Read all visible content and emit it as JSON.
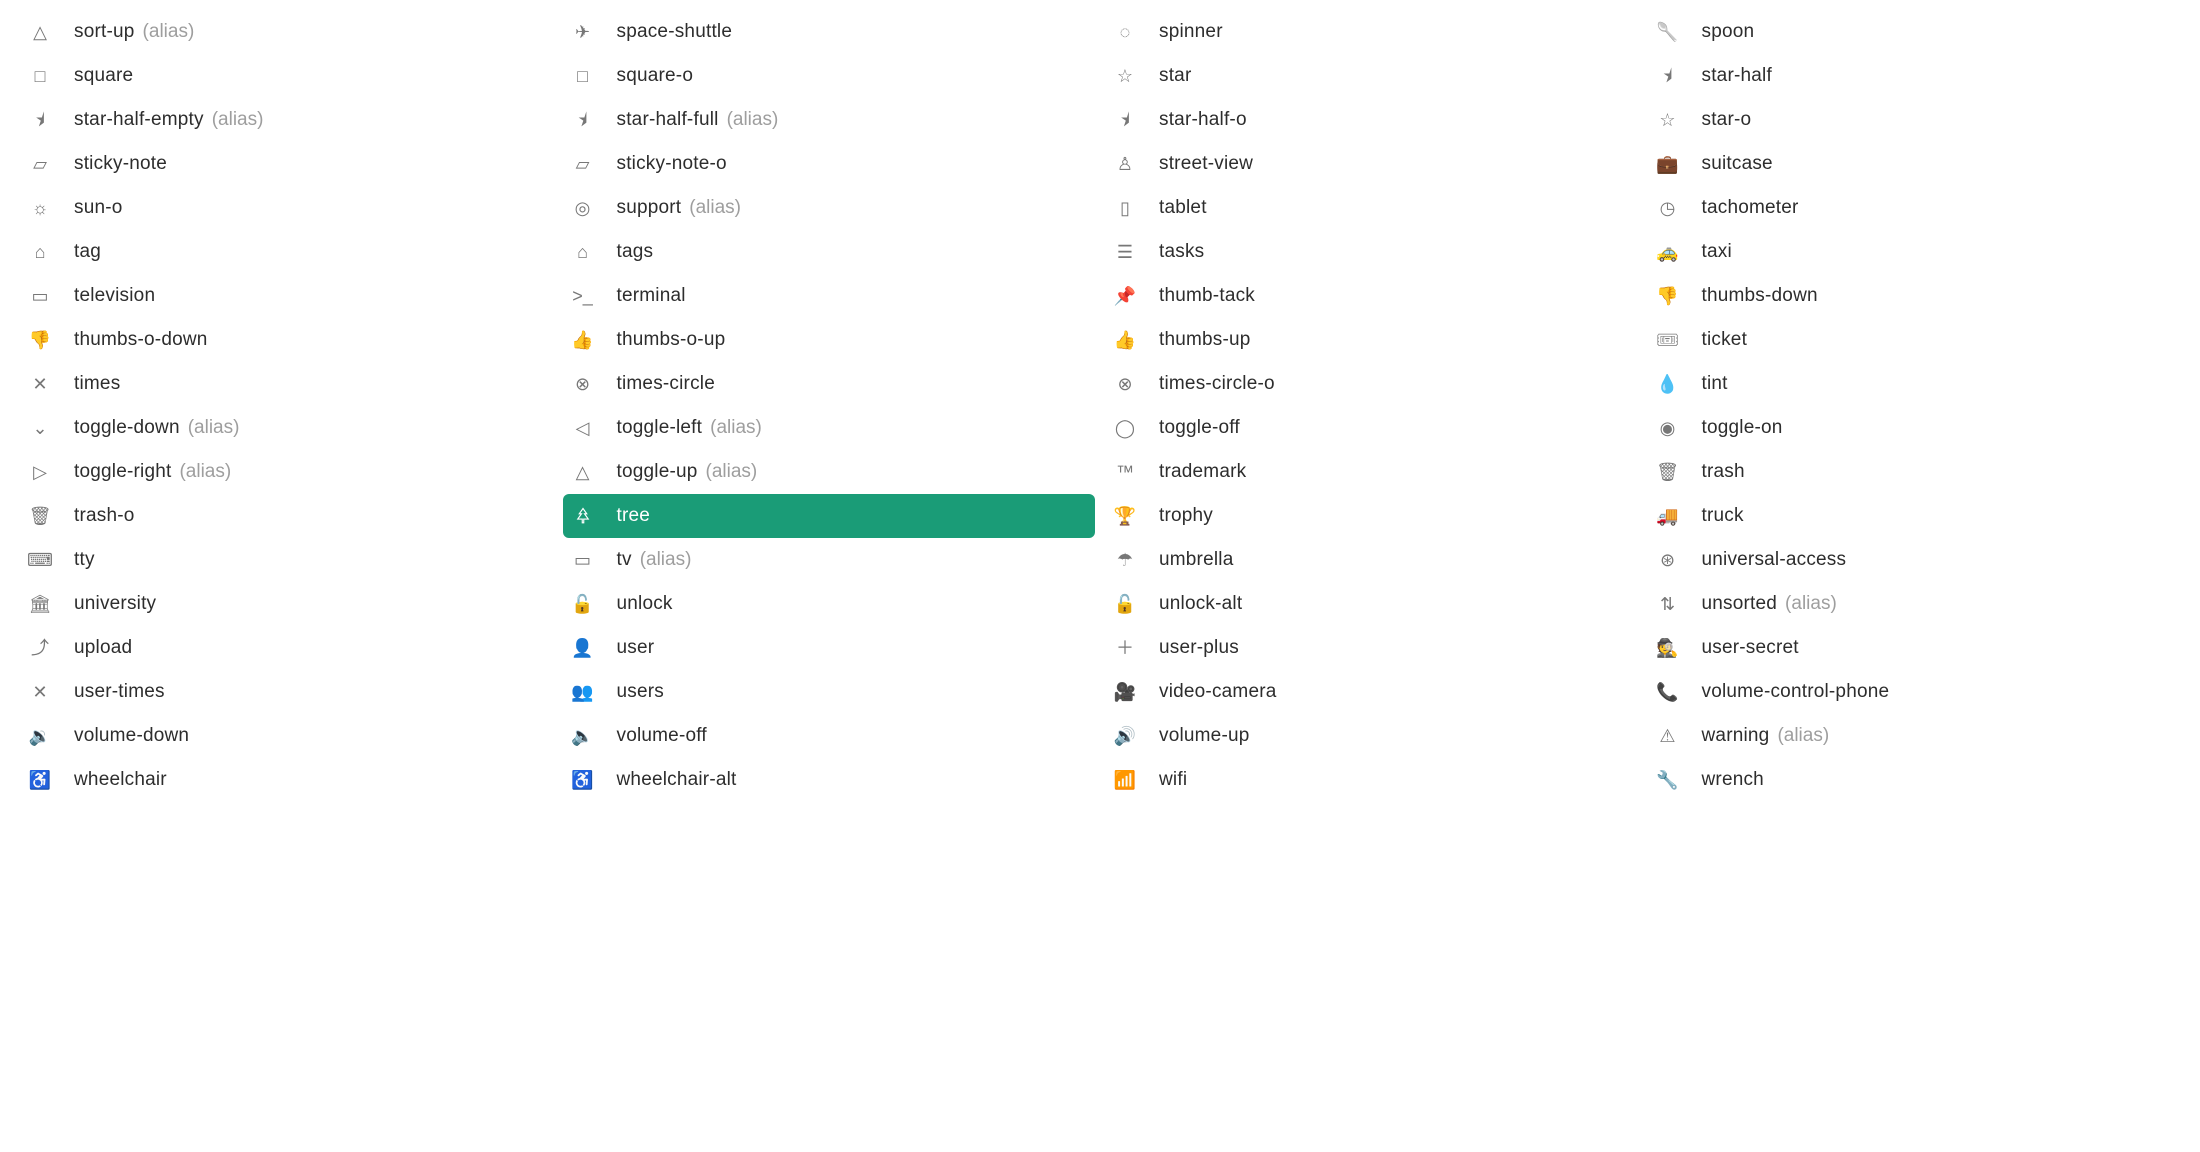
{
  "alias_text": "(alias)",
  "columns": [
    [
      {
        "name": "sort-up",
        "alias": true,
        "glyph": "△"
      },
      {
        "name": "square",
        "glyph": "□"
      },
      {
        "name": "star-half-empty",
        "alias": true,
        "glyph": "⯨"
      },
      {
        "name": "sticky-note",
        "glyph": "▱"
      },
      {
        "name": "sun-o",
        "glyph": "☼"
      },
      {
        "name": "tag",
        "glyph": "⌂"
      },
      {
        "name": "television",
        "glyph": "▭"
      },
      {
        "name": "thumbs-o-down",
        "glyph": "👎"
      },
      {
        "name": "times",
        "glyph": "✕"
      },
      {
        "name": "toggle-down",
        "alias": true,
        "glyph": "⌄"
      },
      {
        "name": "toggle-right",
        "alias": true,
        "glyph": "▷"
      },
      {
        "name": "trash-o",
        "glyph": "🗑"
      },
      {
        "name": "tty",
        "glyph": "⌨"
      },
      {
        "name": "university",
        "glyph": "🏛"
      },
      {
        "name": "upload",
        "glyph": "⤴"
      },
      {
        "name": "user-times",
        "glyph": "✕"
      },
      {
        "name": "volume-down",
        "glyph": "🔉"
      },
      {
        "name": "wheelchair",
        "glyph": "♿"
      }
    ],
    [
      {
        "name": "space-shuttle",
        "glyph": "✈"
      },
      {
        "name": "square-o",
        "glyph": "□"
      },
      {
        "name": "star-half-full",
        "alias": true,
        "glyph": "⯨"
      },
      {
        "name": "sticky-note-o",
        "glyph": "▱"
      },
      {
        "name": "support",
        "alias": true,
        "glyph": "◎"
      },
      {
        "name": "tags",
        "glyph": "⌂"
      },
      {
        "name": "terminal",
        "glyph": ">_"
      },
      {
        "name": "thumbs-o-up",
        "glyph": "👍"
      },
      {
        "name": "times-circle",
        "glyph": "⊗"
      },
      {
        "name": "toggle-left",
        "alias": true,
        "glyph": "◁"
      },
      {
        "name": "toggle-up",
        "alias": true,
        "glyph": "△"
      },
      {
        "name": "tree",
        "glyph": "🌲",
        "selected": true
      },
      {
        "name": "tv",
        "alias": true,
        "glyph": "▭"
      },
      {
        "name": "unlock",
        "glyph": "🔓"
      },
      {
        "name": "user",
        "glyph": "👤"
      },
      {
        "name": "users",
        "glyph": "👥"
      },
      {
        "name": "volume-off",
        "glyph": "🔈"
      },
      {
        "name": "wheelchair-alt",
        "glyph": "♿"
      }
    ],
    [
      {
        "name": "spinner",
        "glyph": "◌"
      },
      {
        "name": "star",
        "glyph": "☆"
      },
      {
        "name": "star-half-o",
        "glyph": "⯨"
      },
      {
        "name": "street-view",
        "glyph": "♙"
      },
      {
        "name": "tablet",
        "glyph": "▯"
      },
      {
        "name": "tasks",
        "glyph": "☰"
      },
      {
        "name": "thumb-tack",
        "glyph": "📌"
      },
      {
        "name": "thumbs-up",
        "glyph": "👍"
      },
      {
        "name": "times-circle-o",
        "glyph": "⊗"
      },
      {
        "name": "toggle-off",
        "glyph": "◯"
      },
      {
        "name": "trademark",
        "glyph": "™"
      },
      {
        "name": "trophy",
        "glyph": "🏆"
      },
      {
        "name": "umbrella",
        "glyph": "☂"
      },
      {
        "name": "unlock-alt",
        "glyph": "🔓"
      },
      {
        "name": "user-plus",
        "glyph": "＋"
      },
      {
        "name": "video-camera",
        "glyph": "🎥"
      },
      {
        "name": "volume-up",
        "glyph": "🔊"
      },
      {
        "name": "wifi",
        "glyph": "📶"
      }
    ],
    [
      {
        "name": "spoon",
        "glyph": "🥄"
      },
      {
        "name": "star-half",
        "glyph": "⯨"
      },
      {
        "name": "star-o",
        "glyph": "☆"
      },
      {
        "name": "suitcase",
        "glyph": "💼"
      },
      {
        "name": "tachometer",
        "glyph": "◷"
      },
      {
        "name": "taxi",
        "glyph": "🚕"
      },
      {
        "name": "thumbs-down",
        "glyph": "👎"
      },
      {
        "name": "ticket",
        "glyph": "🎟"
      },
      {
        "name": "tint",
        "glyph": "💧"
      },
      {
        "name": "toggle-on",
        "glyph": "◉"
      },
      {
        "name": "trash",
        "glyph": "🗑"
      },
      {
        "name": "truck",
        "glyph": "🚚"
      },
      {
        "name": "universal-access",
        "glyph": "⊛"
      },
      {
        "name": "unsorted",
        "alias": true,
        "glyph": "⇅"
      },
      {
        "name": "user-secret",
        "glyph": "🕵"
      },
      {
        "name": "volume-control-phone",
        "glyph": "📞"
      },
      {
        "name": "warning",
        "alias": true,
        "glyph": "⚠"
      },
      {
        "name": "wrench",
        "glyph": "🔧"
      }
    ]
  ]
}
